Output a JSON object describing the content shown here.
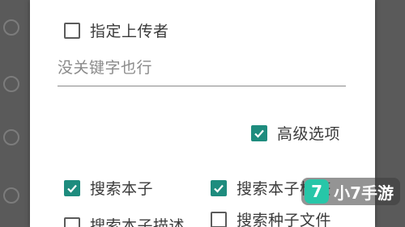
{
  "dialog": {
    "uploader": {
      "label": "指定上传者",
      "checked": false
    },
    "keyword": {
      "placeholder": "没关键字也行",
      "value": ""
    },
    "advanced": {
      "label": "高级选项",
      "checked": true
    },
    "options": [
      {
        "label": "搜索本子",
        "checked": true
      },
      {
        "label": "搜索本子标签",
        "checked": true
      },
      {
        "label": "搜索本子描述",
        "checked": false
      },
      {
        "label": "搜索种子文件",
        "checked": false
      }
    ]
  },
  "watermark": {
    "logo": "7",
    "text": "小7手游"
  },
  "colors": {
    "accent": "#1e8c7e",
    "overlay": "#5a5a5a"
  },
  "icons": {
    "checked": "checkmark-icon"
  }
}
